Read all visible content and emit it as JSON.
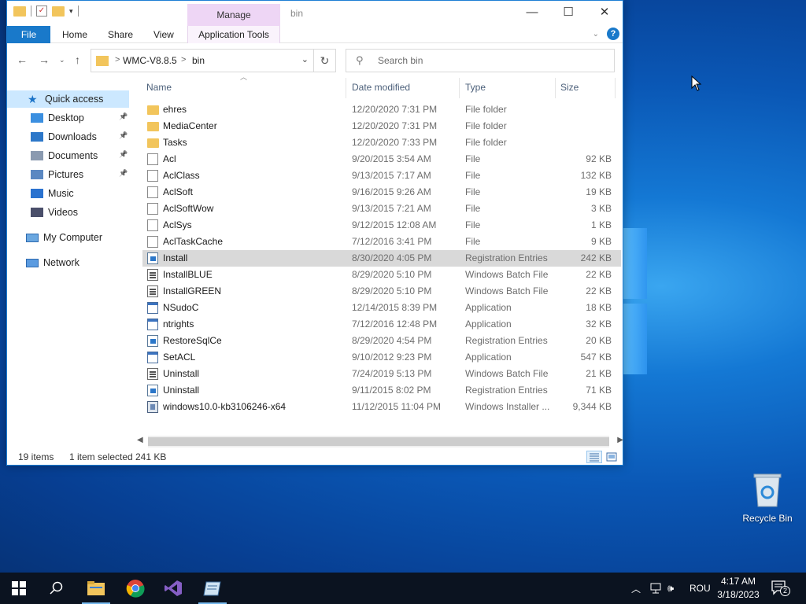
{
  "window": {
    "title": "bin",
    "manage_tab": "Manage",
    "controls": {
      "minimize": "—",
      "maximize": "☐",
      "close": "✕"
    }
  },
  "ribbon": {
    "tabs": [
      "File",
      "Home",
      "Share",
      "View",
      "Application Tools"
    ],
    "help": "?"
  },
  "address": {
    "crumbs": [
      "WMC-V8.8.5",
      "bin"
    ],
    "separator": ">"
  },
  "search": {
    "placeholder": "Search bin"
  },
  "nav_pane": {
    "quick_access": "Quick access",
    "items": [
      {
        "label": "Desktop",
        "icon": "desktop-icon",
        "pinned": true
      },
      {
        "label": "Downloads",
        "icon": "download-arrow-icon",
        "pinned": true
      },
      {
        "label": "Documents",
        "icon": "documents-icon",
        "pinned": true
      },
      {
        "label": "Pictures",
        "icon": "pictures-icon",
        "pinned": true
      },
      {
        "label": "Music",
        "icon": "music-note-icon",
        "pinned": false
      },
      {
        "label": "Videos",
        "icon": "videos-icon",
        "pinned": false
      }
    ],
    "my_computer": "My Computer",
    "network": "Network"
  },
  "columns": {
    "name": "Name",
    "date": "Date modified",
    "type": "Type",
    "size": "Size"
  },
  "files": [
    {
      "name": "ehres",
      "date": "12/20/2020 7:31 PM",
      "type": "File folder",
      "size": "",
      "icon": "folder"
    },
    {
      "name": "MediaCenter",
      "date": "12/20/2020 7:31 PM",
      "type": "File folder",
      "size": "",
      "icon": "folder"
    },
    {
      "name": "Tasks",
      "date": "12/20/2020 7:33 PM",
      "type": "File folder",
      "size": "",
      "icon": "folder"
    },
    {
      "name": "Acl",
      "date": "9/20/2015 3:54 AM",
      "type": "File",
      "size": "92 KB",
      "icon": "file"
    },
    {
      "name": "AclClass",
      "date": "9/13/2015 7:17 AM",
      "type": "File",
      "size": "132 KB",
      "icon": "file"
    },
    {
      "name": "AclSoft",
      "date": "9/16/2015 9:26 AM",
      "type": "File",
      "size": "19 KB",
      "icon": "file"
    },
    {
      "name": "AclSoftWow",
      "date": "9/13/2015 7:21 AM",
      "type": "File",
      "size": "3 KB",
      "icon": "file"
    },
    {
      "name": "AclSys",
      "date": "9/12/2015 12:08 AM",
      "type": "File",
      "size": "1 KB",
      "icon": "file"
    },
    {
      "name": "AclTaskCache",
      "date": "7/12/2016 3:41 PM",
      "type": "File",
      "size": "9 KB",
      "icon": "file"
    },
    {
      "name": "Install",
      "date": "8/30/2020 4:05 PM",
      "type": "Registration Entries",
      "size": "242 KB",
      "icon": "reg",
      "selected": true
    },
    {
      "name": "InstallBLUE",
      "date": "8/29/2020 5:10 PM",
      "type": "Windows Batch File",
      "size": "22 KB",
      "icon": "bat"
    },
    {
      "name": "InstallGREEN",
      "date": "8/29/2020 5:10 PM",
      "type": "Windows Batch File",
      "size": "22 KB",
      "icon": "bat"
    },
    {
      "name": "NSudoC",
      "date": "12/14/2015 8:39 PM",
      "type": "Application",
      "size": "18 KB",
      "icon": "app"
    },
    {
      "name": "ntrights",
      "date": "7/12/2016 12:48 PM",
      "type": "Application",
      "size": "32 KB",
      "icon": "app"
    },
    {
      "name": "RestoreSqlCe",
      "date": "8/29/2020 4:54 PM",
      "type": "Registration Entries",
      "size": "20 KB",
      "icon": "reg"
    },
    {
      "name": "SetACL",
      "date": "9/10/2012 9:23 PM",
      "type": "Application",
      "size": "547 KB",
      "icon": "app"
    },
    {
      "name": "Uninstall",
      "date": "7/24/2019 5:13 PM",
      "type": "Windows Batch File",
      "size": "21 KB",
      "icon": "bat"
    },
    {
      "name": "Uninstall",
      "date": "9/11/2015 8:02 PM",
      "type": "Registration Entries",
      "size": "71 KB",
      "icon": "reg"
    },
    {
      "name": "windows10.0-kb3106246-x64",
      "date": "11/12/2015 11:04 PM",
      "type": "Windows Installer ...",
      "size": "9,344 KB",
      "icon": "msi"
    }
  ],
  "status": {
    "items": "19 items",
    "selected": "1 item selected",
    "size": "241 KB"
  },
  "desktop": {
    "recycle_bin": "Recycle Bin"
  },
  "taskbar": {
    "apps": [
      "start-icon",
      "search-icon",
      "file-explorer-icon",
      "chrome-icon",
      "visual-studio-icon",
      "notepad-icon"
    ],
    "language": "ROU",
    "time": "4:17 AM",
    "date": "3/18/2023",
    "notifications": "2"
  }
}
